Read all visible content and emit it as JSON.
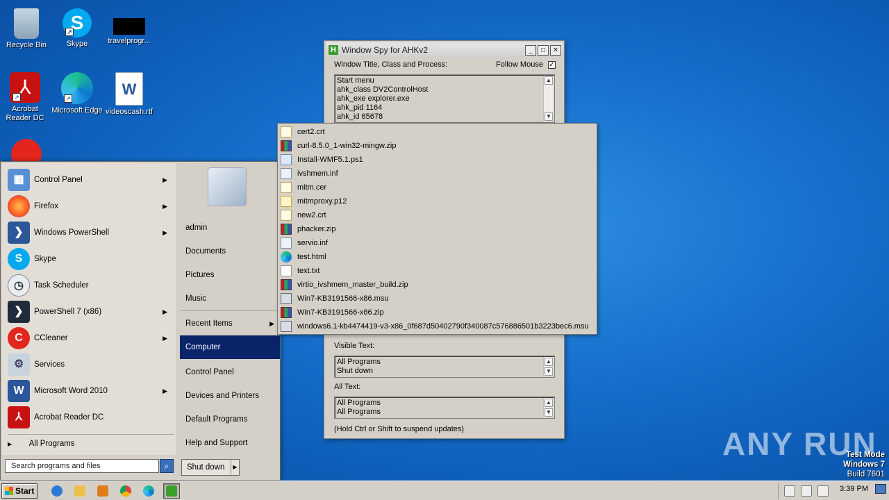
{
  "desktop": {
    "icons": [
      {
        "label": "Recycle Bin"
      },
      {
        "label": "Skype"
      },
      {
        "label": "travelprogr..."
      },
      {
        "label": "Acrobat Reader DC"
      },
      {
        "label": "Microsoft Edge"
      },
      {
        "label": "videoscash.rtf"
      }
    ]
  },
  "spy": {
    "title": "Window Spy for AHKv2",
    "section_title": "Window Title, Class and Process:",
    "follow_mouse_label": "Follow Mouse",
    "follow_mouse_checked": true,
    "window_info": [
      "Start menu",
      "ahk_class DV2ControlHost",
      "ahk_exe explorer.exe",
      "ahk_pid 1164",
      "ahk_id 65678"
    ],
    "visible_text_label": "Visible Text:",
    "visible_text": [
      "All Programs",
      "Shut down"
    ],
    "all_text_label": "All Text:",
    "all_text": [
      "All Programs",
      "All Programs"
    ],
    "footer": "(Hold Ctrl or Shift to suspend updates)"
  },
  "start_menu": {
    "programs": [
      {
        "label": "Control Panel",
        "icon": "control-panel-icon",
        "submenu": true
      },
      {
        "label": "Firefox",
        "icon": "firefox-icon",
        "submenu": true
      },
      {
        "label": "Windows PowerShell",
        "icon": "powershell-icon",
        "submenu": true
      },
      {
        "label": "Skype",
        "icon": "skype-icon",
        "submenu": false
      },
      {
        "label": "Task Scheduler",
        "icon": "task-scheduler-icon",
        "submenu": false
      },
      {
        "label": "PowerShell 7 (x86)",
        "icon": "powershell7-icon",
        "submenu": true
      },
      {
        "label": "CCleaner",
        "icon": "ccleaner-icon",
        "submenu": true
      },
      {
        "label": "Services",
        "icon": "services-icon",
        "submenu": false
      },
      {
        "label": "Microsoft Word 2010",
        "icon": "word-icon",
        "submenu": true
      },
      {
        "label": "Acrobat Reader DC",
        "icon": "acrobat-icon",
        "submenu": false
      }
    ],
    "all_programs": "All Programs",
    "search_placeholder": "Search programs and files",
    "right": {
      "user": "admin",
      "documents": "Documents",
      "pictures": "Pictures",
      "music": "Music",
      "recent_items": "Recent Items",
      "computer": "Computer",
      "control_panel": "Control Panel",
      "devices_printers": "Devices and Printers",
      "default_programs": "Default Programs",
      "help_support": "Help and Support"
    },
    "shutdown": "Shut down"
  },
  "recent_items": [
    {
      "name": "cert2.crt",
      "type": "cert"
    },
    {
      "name": "curl-8.5.0_1-win32-mingw.zip",
      "type": "zip"
    },
    {
      "name": "Install-WMF5.1.ps1",
      "type": "ps"
    },
    {
      "name": "ivshmem.inf",
      "type": "inf"
    },
    {
      "name": "mitm.cer",
      "type": "cert"
    },
    {
      "name": "mitmproxy.p12",
      "type": "pfx"
    },
    {
      "name": "new2.crt",
      "type": "cert"
    },
    {
      "name": "phacker.zip",
      "type": "zip"
    },
    {
      "name": "servio.inf",
      "type": "inf"
    },
    {
      "name": "test.html",
      "type": "edge"
    },
    {
      "name": "text.txt",
      "type": "txt"
    },
    {
      "name": "virtio_ivshmem_master_build.zip",
      "type": "zip"
    },
    {
      "name": "Win7-KB3191566-x86.msu",
      "type": "msu"
    },
    {
      "name": "Win7-KB3191566-x86.zip",
      "type": "zip"
    },
    {
      "name": "windows6.1-kb4474419-v3-x86_0f687d50402790f340087c576886501b3223bec6.msu",
      "type": "msu"
    }
  ],
  "taskbar": {
    "start": "Start",
    "clock": "3:39 PM"
  },
  "watermark": {
    "brand": "ANY RUN",
    "line1": "Test Mode",
    "line2": "Windows 7",
    "line3": "Build 7601"
  }
}
